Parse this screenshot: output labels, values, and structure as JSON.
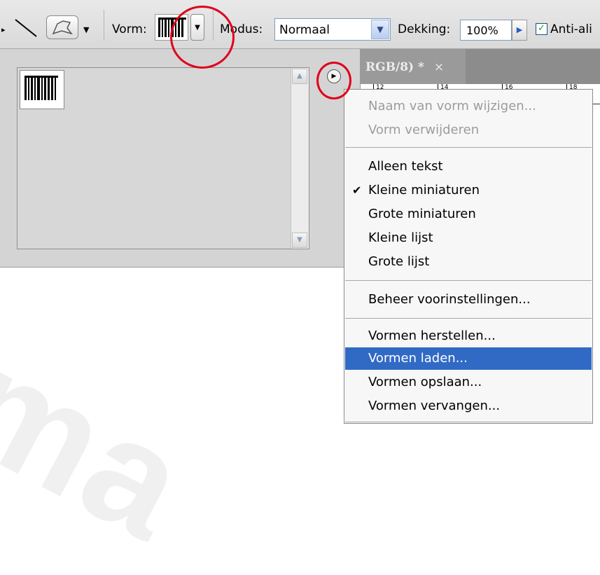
{
  "toolbar": {
    "vorm_label": "Vorm:",
    "modus_label": "Modus:",
    "modus_value": "Normaal",
    "dekking_label": "Dekking:",
    "dekking_value": "100%",
    "anti_alias_label": "Anti-ali",
    "anti_alias_checked": true
  },
  "document_tab": {
    "title": "RGB/8) *",
    "close": "×"
  },
  "ruler": {
    "numbers": [
      "12",
      "14",
      "16",
      "18"
    ]
  },
  "context_menu": {
    "items": [
      {
        "label": "Naam van vorm wijzigen...",
        "disabled": true
      },
      {
        "label": "Vorm verwijderen",
        "disabled": true
      },
      {
        "label": "Alleen tekst"
      },
      {
        "label": "Kleine miniaturen",
        "checked": true
      },
      {
        "label": "Grote miniaturen"
      },
      {
        "label": "Kleine lijst"
      },
      {
        "label": "Grote lijst"
      },
      {
        "label": "Beheer voorinstellingen..."
      },
      {
        "label": "Vormen herstellen..."
      },
      {
        "label": "Vormen laden...",
        "highlighted": true
      },
      {
        "label": "Vormen opslaan..."
      },
      {
        "label": "Vormen vervangen..."
      }
    ],
    "checkmark": "✔",
    "highlight_color": "#316ac5"
  },
  "icons": {
    "line_tool": "line-tool-icon",
    "custom_shape_tool": "custom-shape-icon",
    "panel_menu": "panel-menu-arrow-icon"
  },
  "watermark": "ma",
  "annotation_color": "#e0001b"
}
